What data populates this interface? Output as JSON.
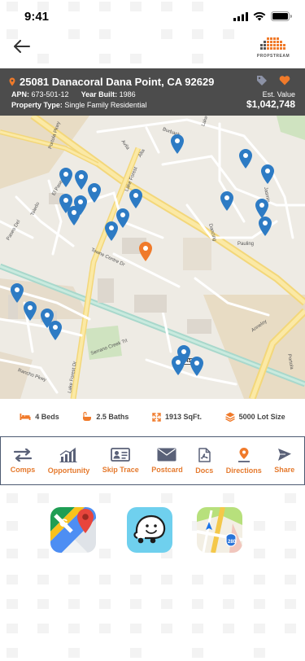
{
  "status_bar": {
    "time": "9:41"
  },
  "brand": {
    "logo_text": "PROPSTREAM",
    "accent": "#f07a2a",
    "pin_blue": "#2d7bc4"
  },
  "property": {
    "address": "25081 Danacoral Dana Point, CA 92629",
    "apn_label": "APN:",
    "apn": "673-501-12",
    "year_built_label": "Year Built:",
    "year_built": "1986",
    "type_label": "Property Type:",
    "type": "Single Family Residential",
    "est_value_label": "Est. Value",
    "est_value": "$1,042,748"
  },
  "map": {
    "road_labels": [
      "Portola Pkwy",
      "Burbank",
      "Lake Forest Dr",
      "El Paseo",
      "Toledo",
      "Paseo Del",
      "Avila",
      "Alta",
      "Lake Forest",
      "Dancing",
      "Pauling",
      "Towne Centre Dr",
      "Serrano Creek Trl",
      "Rancho Pkwy",
      "Lake Forest Dr",
      "Portola",
      "Anneloy",
      "Jasmin"
    ],
    "highway_shield": "241",
    "pin_count_blue": 25,
    "pin_count_selected": 1
  },
  "features": {
    "beds": "4 Beds",
    "baths": "2.5 Baths",
    "sqft": "1913 SqFt.",
    "lot": "5000 Lot Size"
  },
  "actions": [
    {
      "label": "Comps",
      "icon": "comps-icon"
    },
    {
      "label": "Opportunity",
      "icon": "opportunity-icon"
    },
    {
      "label": "Skip Trace",
      "icon": "skip-trace-icon"
    },
    {
      "label": "Postcard",
      "icon": "postcard-icon"
    },
    {
      "label": "Docs",
      "icon": "docs-icon"
    },
    {
      "label": "Directions",
      "icon": "directions-icon"
    },
    {
      "label": "Share",
      "icon": "share-icon"
    }
  ],
  "nav_apps": [
    {
      "name": "Google Maps",
      "icon": "google-maps-icon"
    },
    {
      "name": "Waze",
      "icon": "waze-icon"
    },
    {
      "name": "Apple Maps",
      "icon": "apple-maps-icon"
    }
  ]
}
